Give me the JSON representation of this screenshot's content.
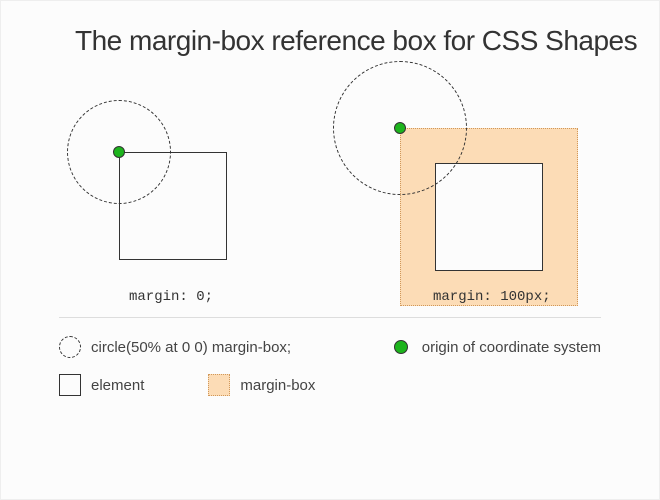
{
  "title": "The margin-box reference box for CSS Shapes",
  "figures": {
    "left": {
      "caption": "margin: 0;"
    },
    "right": {
      "caption": "margin: 100px;"
    }
  },
  "legend": {
    "shape_func": "circle(50% at 0 0) margin-box;",
    "origin": "origin of coordinate system",
    "element": "element",
    "margin_box": "margin-box"
  }
}
